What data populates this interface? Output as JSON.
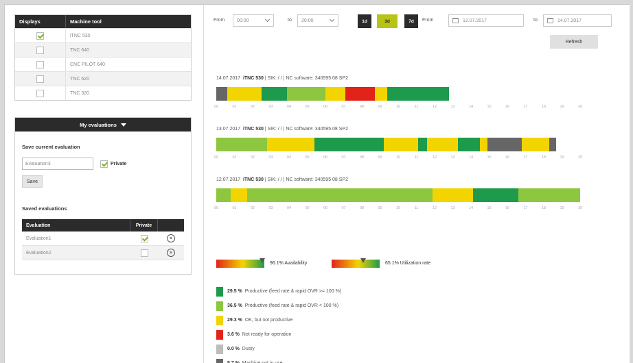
{
  "machine_table": {
    "headers": [
      "Displays",
      "Machine tool"
    ],
    "rows": [
      {
        "name": "iTNC 530",
        "checked": true
      },
      {
        "name": "TNC 640",
        "checked": false
      },
      {
        "name": "CNC PILOT 640",
        "checked": false
      },
      {
        "name": "TNC 620",
        "checked": false
      },
      {
        "name": "TNC 320",
        "checked": false
      }
    ]
  },
  "my_evaluations": {
    "header": "My evaluations",
    "save_current_label": "Save current evaluation",
    "input_value": "Evaluation3",
    "private_label": "Private",
    "private_checked": true,
    "save_button": "Save",
    "saved_label": "Saved evaluations",
    "table_headers": [
      "Evaluation",
      "Private"
    ],
    "rows": [
      {
        "name": "Evaluation1",
        "private": true
      },
      {
        "name": "Evaluation2",
        "private": false
      }
    ]
  },
  "controls": {
    "from_label": "From",
    "from_time": "00:00",
    "to_label": "to",
    "to_time": "20:00",
    "range_buttons": [
      "1d",
      "3d",
      "7d"
    ],
    "active_range": "3d",
    "date_from_label": "From",
    "date_from": "12.07.2017",
    "date_to_label": "to",
    "date_to": "14.07.2017",
    "refresh_button": "Refresh"
  },
  "colors": {
    "productive_dark": "#1e9a4c",
    "productive_light": "#8dc63f",
    "ok_not_productive": "#f2d500",
    "not_ready": "#e2231a",
    "dusty": "#bdbdbd",
    "not_in_use": "#666666"
  },
  "timelines": [
    {
      "date": "14.07.2017",
      "machine": "iTNC 530",
      "details": "| SIK:  /  /  | NC software: 340595 08 SP2",
      "segments": [
        {
          "state": "not_in_use",
          "hours": 0.6
        },
        {
          "state": "ok_not_productive",
          "hours": 1.9
        },
        {
          "state": "productive_dark",
          "hours": 1.4
        },
        {
          "state": "productive_light",
          "hours": 2.1
        },
        {
          "state": "ok_not_productive",
          "hours": 1.1
        },
        {
          "state": "not_ready",
          "hours": 1.6
        },
        {
          "state": "ok_not_productive",
          "hours": 0.7
        },
        {
          "state": "productive_dark",
          "hours": 3.4
        }
      ]
    },
    {
      "date": "13.07.2017",
      "machine": "iTNC 530",
      "details": "| SIK:  /  /  | NC software: 340595 08 SP2",
      "segments": [
        {
          "state": "productive_light",
          "hours": 2.8
        },
        {
          "state": "ok_not_productive",
          "hours": 2.6
        },
        {
          "state": "productive_dark",
          "hours": 3.8
        },
        {
          "state": "ok_not_productive",
          "hours": 1.9
        },
        {
          "state": "productive_dark",
          "hours": 0.5
        },
        {
          "state": "ok_not_productive",
          "hours": 1.7
        },
        {
          "state": "productive_dark",
          "hours": 1.2
        },
        {
          "state": "ok_not_productive",
          "hours": 0.4
        },
        {
          "state": "not_in_use",
          "hours": 1.9
        },
        {
          "state": "ok_not_productive",
          "hours": 1.5
        },
        {
          "state": "not_in_use",
          "hours": 0.4
        }
      ]
    },
    {
      "date": "12.07.2017",
      "machine": "iTNC 530",
      "details": "| SIK:  /  /  | NC software: 340595 08 SP2",
      "segments": [
        {
          "state": "productive_light",
          "hours": 0.8
        },
        {
          "state": "ok_not_productive",
          "hours": 0.9
        },
        {
          "state": "productive_light",
          "hours": 10.2
        },
        {
          "state": "ok_not_productive",
          "hours": 2.2
        },
        {
          "state": "productive_dark",
          "hours": 2.5
        },
        {
          "state": "productive_light",
          "hours": 3.4
        }
      ]
    }
  ],
  "axis_ticks": [
    "00",
    "01",
    "02",
    "03",
    "04",
    "05",
    "06",
    "07",
    "08",
    "09",
    "10",
    "11",
    "12",
    "13",
    "14",
    "15",
    "16",
    "17",
    "18",
    "19",
    "20"
  ],
  "kpis": {
    "availability_text": "96.1% Availability",
    "availability_value": 0.961,
    "utilization_text": "65.1% Utilization rate",
    "utilization_value": 0.651
  },
  "legend": [
    {
      "state": "productive_dark",
      "pct": "29.5 %",
      "text": "Productive (feed rate & rapid OVR >= 100 %)"
    },
    {
      "state": "productive_light",
      "pct": "36.5 %",
      "text": "Productive (feed rate & rapid OVR < 100 %)"
    },
    {
      "state": "ok_not_productive",
      "pct": "29.3 %",
      "text": "OK, but not productive"
    },
    {
      "state": "not_ready",
      "pct": "3.6 %",
      "text": "Not ready for operation"
    },
    {
      "state": "dusty",
      "pct": "0.0 %",
      "text": "Dusty"
    },
    {
      "state": "not_in_use",
      "pct": "5.7 %",
      "text": "Machine not in use"
    }
  ]
}
